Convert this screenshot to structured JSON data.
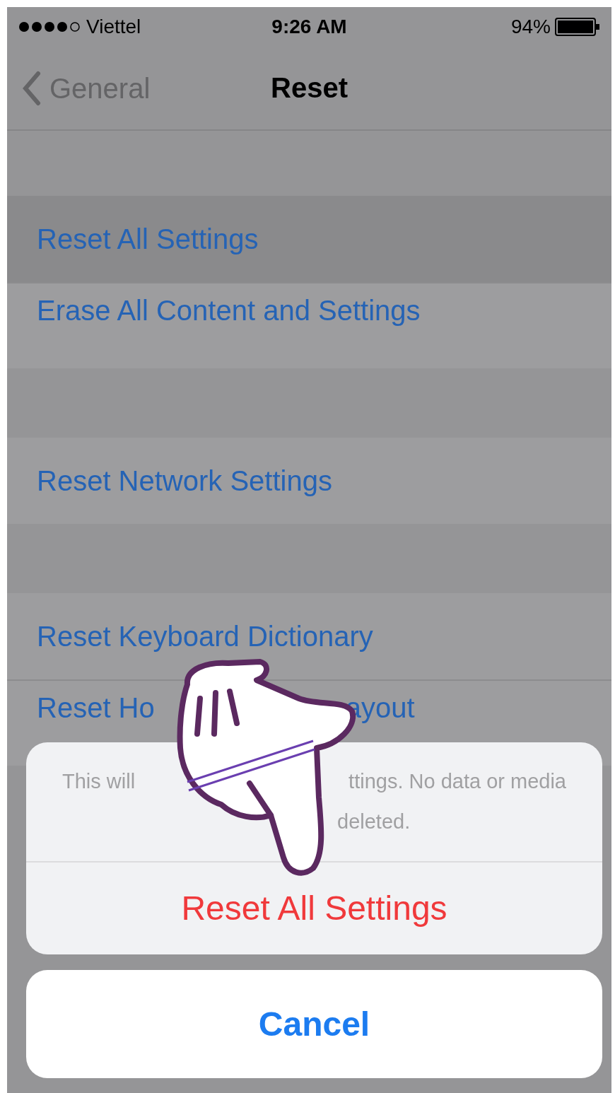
{
  "status_bar": {
    "carrier": "Viettel",
    "time": "9:26 AM",
    "battery": "94%"
  },
  "nav": {
    "back": "General",
    "title": "Reset"
  },
  "groups": [
    {
      "rows": [
        {
          "parts": [
            "Reset All Settings"
          ],
          "selected": true
        },
        {
          "parts": [
            "Erase All Content and Settings"
          ],
          "selected": false
        }
      ]
    },
    {
      "rows": [
        {
          "parts": [
            "Reset Network Settings"
          ],
          "selected": false
        }
      ]
    },
    {
      "rows": [
        {
          "parts": [
            "Reset Keyboard Dictionary"
          ],
          "selected": false
        },
        {
          "parts": [
            "Reset Ho",
            "ayout"
          ],
          "selected": false
        }
      ]
    }
  ],
  "alert": {
    "message_lines": [
      [
        "This will",
        "ttings. No data or media"
      ],
      [
        "deleted."
      ]
    ],
    "action": "Reset All Settings",
    "cancel": "Cancel"
  }
}
